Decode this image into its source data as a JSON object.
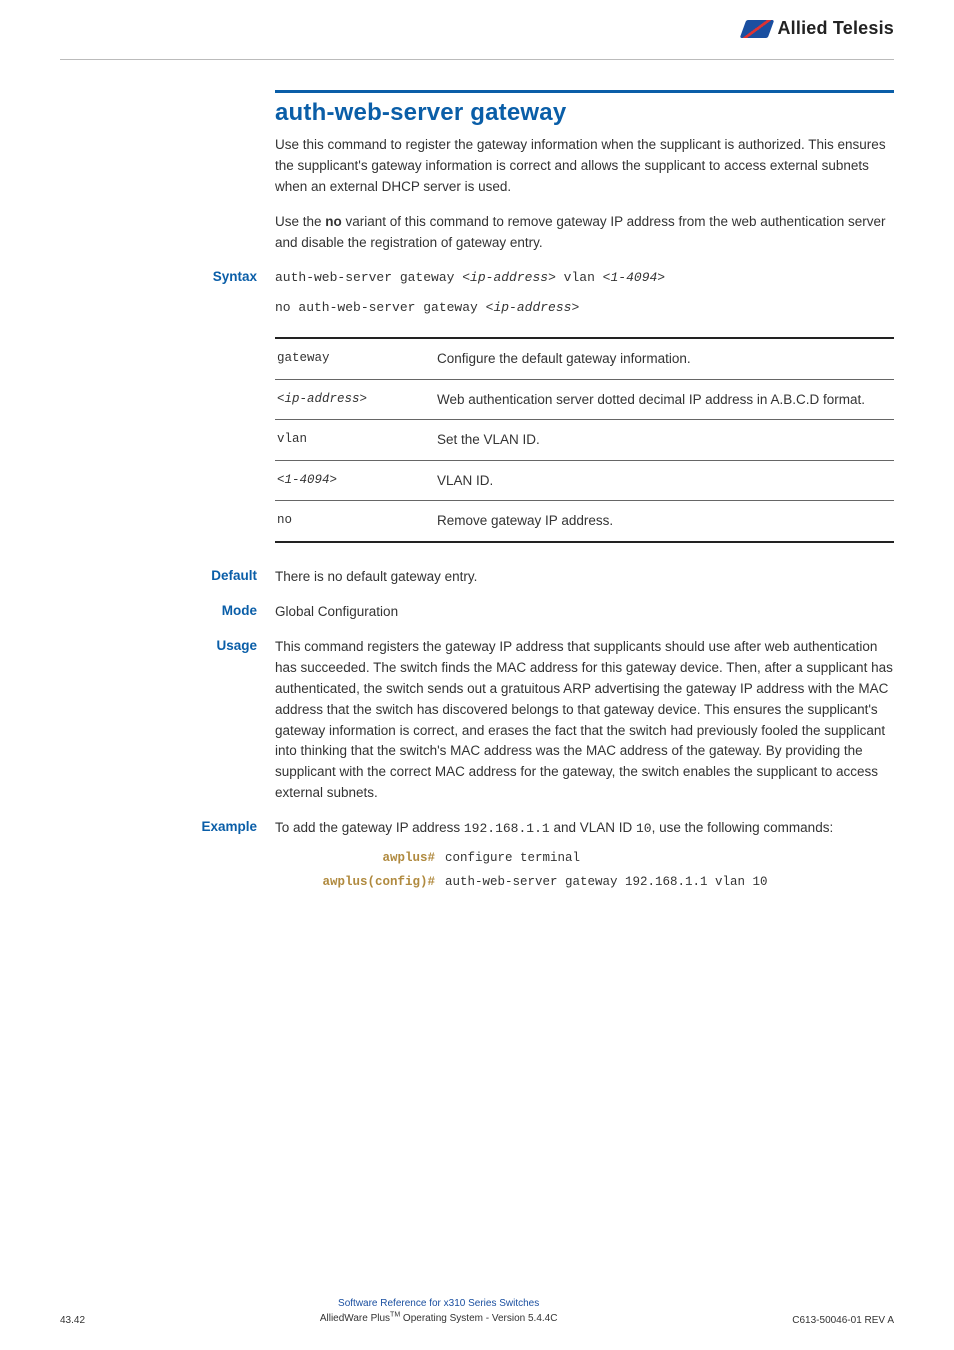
{
  "logo": {
    "text": "Allied Telesis"
  },
  "title": "auth-web-server gateway",
  "intro1": "Use this command to register the gateway information when the supplicant is authorized. This ensures the supplicant's gateway information is correct and allows the supplicant to access external subnets when an external DHCP server is used.",
  "intro2_a": "Use the ",
  "intro2_b": "no",
  "intro2_c": " variant of this command to remove gateway IP address from the web authentication server and disable the registration of gateway entry.",
  "labels": {
    "syntax": "Syntax",
    "default": "Default",
    "mode": "Mode",
    "usage": "Usage",
    "example": "Example"
  },
  "syntax": {
    "l1a": "auth-web-server gateway <",
    "l1b": "ip-address",
    "l1c": "> vlan <",
    "l1d": "1-4094",
    "l1e": ">",
    "l2a": "no auth-web-server gateway <",
    "l2b": "ip-address",
    "l2c": ">"
  },
  "params": [
    {
      "name": "gateway",
      "italic": false,
      "desc": "Configure the default gateway information."
    },
    {
      "name": "<ip-address>",
      "italic": true,
      "desc": "Web authentication server dotted decimal IP address in A.B.C.D format."
    },
    {
      "name": "vlan",
      "italic": false,
      "desc": "Set the VLAN ID."
    },
    {
      "name": "<1-4094>",
      "italic": true,
      "desc": "VLAN ID."
    },
    {
      "name": "no",
      "italic": false,
      "desc": "Remove gateway IP address."
    }
  ],
  "default_text": "There is no default gateway entry.",
  "mode_text": "Global Configuration",
  "usage_text": "This command registers the gateway IP address that supplicants should use after web authentication has succeeded. The switch finds the MAC address for this gateway device. Then, after a supplicant has authenticated, the switch sends out a gratuitous ARP advertising the gateway IP address with the MAC address that the switch has discovered belongs to that gateway device. This ensures the supplicant's gateway information is correct, and erases the fact that the switch had previously fooled the supplicant into thinking that the switch's MAC address was the MAC address of the gateway. By providing the supplicant with the correct MAC address for the gateway, the switch enables the supplicant to access external subnets.",
  "example_a": "To add the gateway IP address ",
  "example_ip": "192.168.1.1",
  "example_b": " and VLAN ID ",
  "example_vlan": "10",
  "example_c": ", use the following commands:",
  "cmdlines": [
    {
      "prompt": "awplus#",
      "cmd": "configure terminal"
    },
    {
      "prompt": "awplus(config)#",
      "cmd": "auth-web-server gateway 192.168.1.1 vlan 10"
    }
  ],
  "footer": {
    "left": "43.42",
    "center1": "Software Reference for x310 Series Switches",
    "center2a": "AlliedWare Plus",
    "center2b": " Operating System  - Version 5.4.4C",
    "right": "C613-50046-01 REV A"
  }
}
